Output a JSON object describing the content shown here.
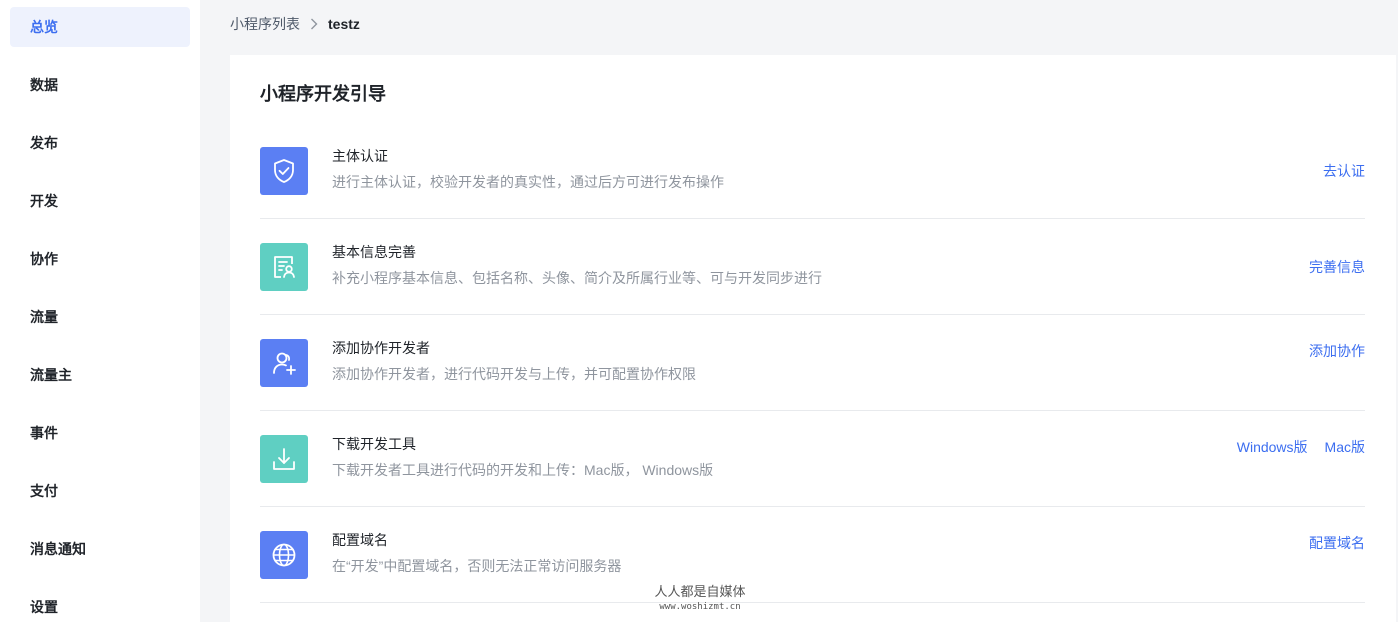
{
  "sidebar": {
    "items": [
      {
        "label": "总览",
        "active": true
      },
      {
        "label": "数据"
      },
      {
        "label": "发布"
      },
      {
        "label": "开发"
      },
      {
        "label": "协作"
      },
      {
        "label": "流量"
      },
      {
        "label": "流量主"
      },
      {
        "label": "事件"
      },
      {
        "label": "支付"
      },
      {
        "label": "消息通知"
      },
      {
        "label": "设置"
      }
    ]
  },
  "breadcrumb": {
    "parent": "小程序列表",
    "current": "testz"
  },
  "main": {
    "title": "小程序开发引导",
    "rows": [
      {
        "icon": "shield-check-icon",
        "title": "主体认证",
        "desc": "进行主体认证，校验开发者的真实性，通过后方可进行发布操作",
        "actions": [
          "去认证"
        ]
      },
      {
        "icon": "profile-card-icon",
        "title": "基本信息完善",
        "desc": "补充小程序基本信息、包括名称、头像、简介及所属行业等、可与开发同步进行",
        "actions": [
          "完善信息"
        ]
      },
      {
        "icon": "add-user-icon",
        "title": "添加协作开发者",
        "desc": "添加协作开发者，进行代码开发与上传，并可配置协作权限",
        "actions": [
          "添加协作"
        ]
      },
      {
        "icon": "download-icon",
        "title": "下载开发工具",
        "desc": "下载开发者工具进行代码的开发和上传：Mac版， Windows版",
        "actions": [
          "Windows版",
          "Mac版"
        ]
      },
      {
        "icon": "globe-icon",
        "title": "配置域名",
        "desc": "在“开发”中配置域名，否则无法正常访问服务器",
        "actions": [
          "配置域名"
        ]
      }
    ]
  },
  "watermark": {
    "line1": "人人都是自媒体",
    "line2": "www.woshizmt.cn"
  },
  "colors": {
    "accent": "#3c6ef0",
    "icon_blue": "#5b7ff3",
    "icon_teal": "#5fcfc2",
    "active_bg": "#eef2fd"
  }
}
